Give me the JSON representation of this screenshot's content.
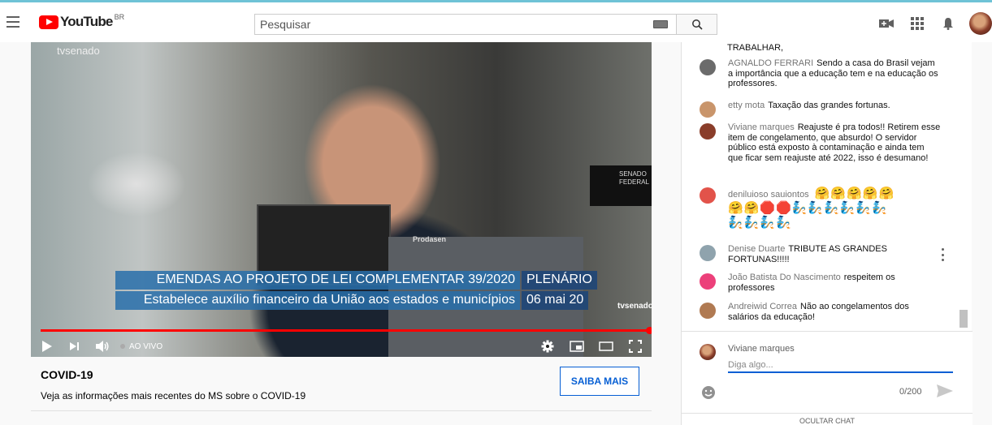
{
  "header": {
    "logo_text": "YouTube",
    "region": "BR",
    "search_placeholder": "Pesquisar"
  },
  "video": {
    "channel_watermark": "tvsenado",
    "desk_plate": "SENADO FEDERAL",
    "monitor_brand": "Prodasen",
    "lower_third_line1": "EMENDAS AO PROJETO DE LEI COMPLEMENTAR 39/2020",
    "lower_third_line2": "Estabelece auxílio financeiro da União aos estados e municípios",
    "lower_third_tag": "PLENÁRIO",
    "lower_third_date": "06 mai 20",
    "corner_logo": "tvsenado",
    "live_label": "AO VIVO",
    "progress": 1.0
  },
  "covid": {
    "title": "COVID-19",
    "description": "Veja as informações mais recentes do MS sobre o COVID-19",
    "button_label": "SAIBA MAIS"
  },
  "chat": {
    "top_text": "TRABALHAR,",
    "messages": [
      {
        "author": "AGNALDO FERRARI",
        "text": "Sendo a casa do Brasil vejam a importância que a educação tem e na educação os professores.",
        "avatar_color": "#6b6b6b"
      },
      {
        "author": "etty mota",
        "text": "Taxação das grandes fortunas.",
        "avatar_color": "#c9956b"
      },
      {
        "author": "Viviane marques",
        "text": "Reajuste é pra todos!! Retirem esse item de congelamento, que absurdo! O servidor público está exposto à contaminação e ainda tem que ficar sem reajuste até 2022, isso é desumano!",
        "avatar_color": "#8a3d2a"
      },
      {
        "author": "deniluioso sauiontos",
        "text": "",
        "emoji_line1": "🤗🤗🤗🤗🤗",
        "emoji_line2": "🤗🤗🛑🛑🧞🧞🧞🧞🧞🧞",
        "emoji_line3": "🧞🧞🧞🧞",
        "avatar_color": "#e2534a"
      },
      {
        "author": "Denise Duarte",
        "text": "TRIBUTE AS GRANDES FORTUNAS!!!!!",
        "avatar_color": "#8fa3ad"
      },
      {
        "author": "João Batista Do Nascimento",
        "text": "respeitem os professores",
        "avatar_color": "#ec407a"
      },
      {
        "author": "Andreiwid Correa",
        "text": "Não ao congelamentos dos salários da educação!",
        "avatar_color": "#b07a52"
      }
    ],
    "input": {
      "user_name": "Viviane marques",
      "placeholder": "Diga algo...",
      "counter": "0/200"
    },
    "hide_chat_label": "OCULTAR CHAT"
  },
  "colors": {
    "accent": "#065fd4",
    "youtube_red": "#ff0000"
  }
}
